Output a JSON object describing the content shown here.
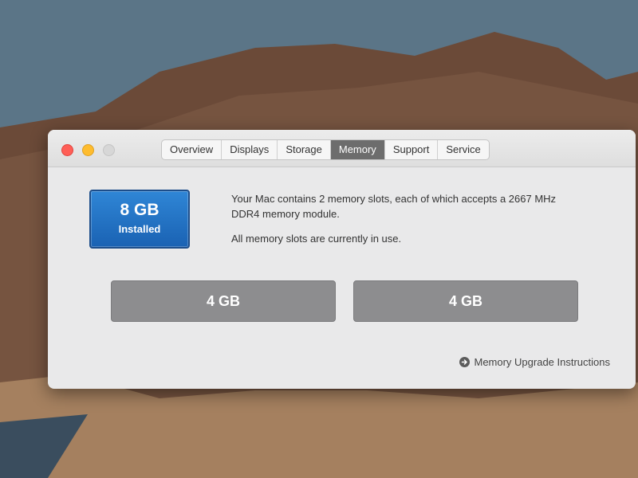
{
  "window": {
    "tabs": [
      {
        "label": "Overview",
        "active": false
      },
      {
        "label": "Displays",
        "active": false
      },
      {
        "label": "Storage",
        "active": false
      },
      {
        "label": "Memory",
        "active": true
      },
      {
        "label": "Support",
        "active": false
      },
      {
        "label": "Service",
        "active": false
      }
    ]
  },
  "memory": {
    "installed_size": "8 GB",
    "installed_label": "Installed",
    "description_line1": "Your Mac contains 2 memory slots, each of which accepts a 2667 MHz DDR4 memory module.",
    "description_line2": "All memory slots are currently in use.",
    "slots": [
      "4 GB",
      "4 GB"
    ],
    "upgrade_link": "Memory Upgrade Instructions"
  },
  "colors": {
    "accent_blue": "#1a62b3",
    "slot_gray": "#8d8d8f",
    "close_red": "#ff5f57",
    "minimize_yellow": "#febc2e"
  }
}
